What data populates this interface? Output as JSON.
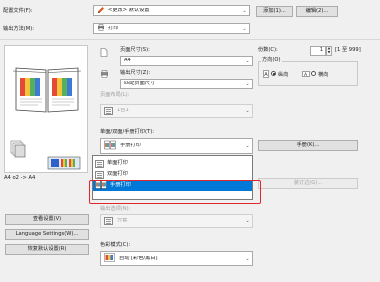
{
  "top": {
    "profile_label": "配置文件(F):",
    "profile_value": "<更改> 默认设置",
    "add_label": "添加(1)...",
    "edit_label": "编辑(2)...",
    "output_label": "输出方法(M):",
    "output_value": "打印"
  },
  "page": {
    "size_label": "页面尺寸(S):",
    "size_value": "A4",
    "output_size_label": "输出尺寸(Z):",
    "output_size_value": "匹配页面尺寸",
    "layout_label": "页面布局(L):",
    "layout_value": "1合1",
    "copies_label": "份数(C):",
    "copies_value": "1",
    "copies_range": "[1 至 999]",
    "orientation_label": "方向(O)",
    "portrait_label": "纵向",
    "landscape_label": "横向",
    "orientation_selected": "portrait"
  },
  "preview": {
    "caption": "A4 o2 -> A4"
  },
  "duplex": {
    "label": "单面/双面/手册打印(T):",
    "value": "手册打印",
    "options": [
      "单面打印",
      "双面打印",
      "手册打印"
    ],
    "selected": "手册打印",
    "booklet_button": "手册(K)...",
    "binding_button": "装订边(G)..."
  },
  "left_buttons": {
    "view_settings": "查看设置(V)",
    "language_settings": "Language Settings(W)...",
    "restore_defaults": "恢复默认设置(R)"
  },
  "lower": {
    "output_options_label": "输出选项(N):",
    "output_options_value": "分套",
    "color_mode_label": "色彩模式(C):",
    "color_mode_value": "自动 [彩色/黑白]"
  },
  "highlight_color": "#e0282a",
  "accent_color": "#0078d7"
}
